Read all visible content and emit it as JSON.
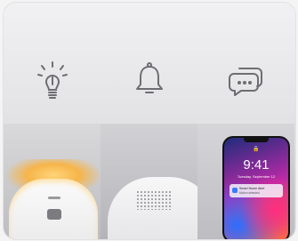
{
  "features": [
    {
      "id": "light",
      "icon": "lightbulb-icon"
    },
    {
      "id": "alert",
      "icon": "bell-icon"
    },
    {
      "id": "message",
      "icon": "chat-bubbles-icon"
    }
  ],
  "phone": {
    "lock_icon": "🔒",
    "time": "9:41",
    "date": "Tuesday, September 12",
    "notification": {
      "title": "Smart Home Alert",
      "body": "Motion detected"
    }
  },
  "colors": {
    "glow": "#f6b54a",
    "icon_stroke": "#6e6e72"
  }
}
